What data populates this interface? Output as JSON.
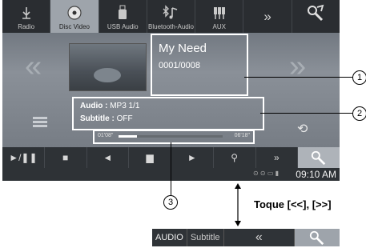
{
  "sources": [
    {
      "label": "Radio",
      "icon": "radio-antenna-icon"
    },
    {
      "label": "Disc Video",
      "icon": "disc-icon"
    },
    {
      "label": "USB Audio",
      "icon": "usb-icon"
    },
    {
      "label": "Bluetooth-Audio",
      "icon": "bluetooth-audio-icon"
    },
    {
      "label": "AUX",
      "icon": "aux-icon"
    },
    {
      "label": "",
      "icon": "more-sources-icon"
    },
    {
      "label": "",
      "icon": "settings-icon"
    }
  ],
  "now_playing": {
    "title": "My Need",
    "track": "0001/0008"
  },
  "audio_info": {
    "audio_label": "Audio :",
    "audio_value": "MP3 1/1",
    "subtitle_label": "Subtitle :",
    "subtitle_value": "OFF"
  },
  "progress": {
    "elapsed": "01'08\"",
    "total": "06'18\"",
    "fraction": 0.18
  },
  "clock": "09:10 AM",
  "callouts": [
    "1",
    "2",
    "3"
  ],
  "tap_label": "Toque [<<], [>>]",
  "bottom_bar": {
    "audio": "AUDIO",
    "subtitle": "Subtitle",
    "arrow": "«"
  },
  "colors": {
    "screen_bg": "#6e747c",
    "active_tab": "#9ea4ab",
    "bar_dark": "#2e3236"
  }
}
